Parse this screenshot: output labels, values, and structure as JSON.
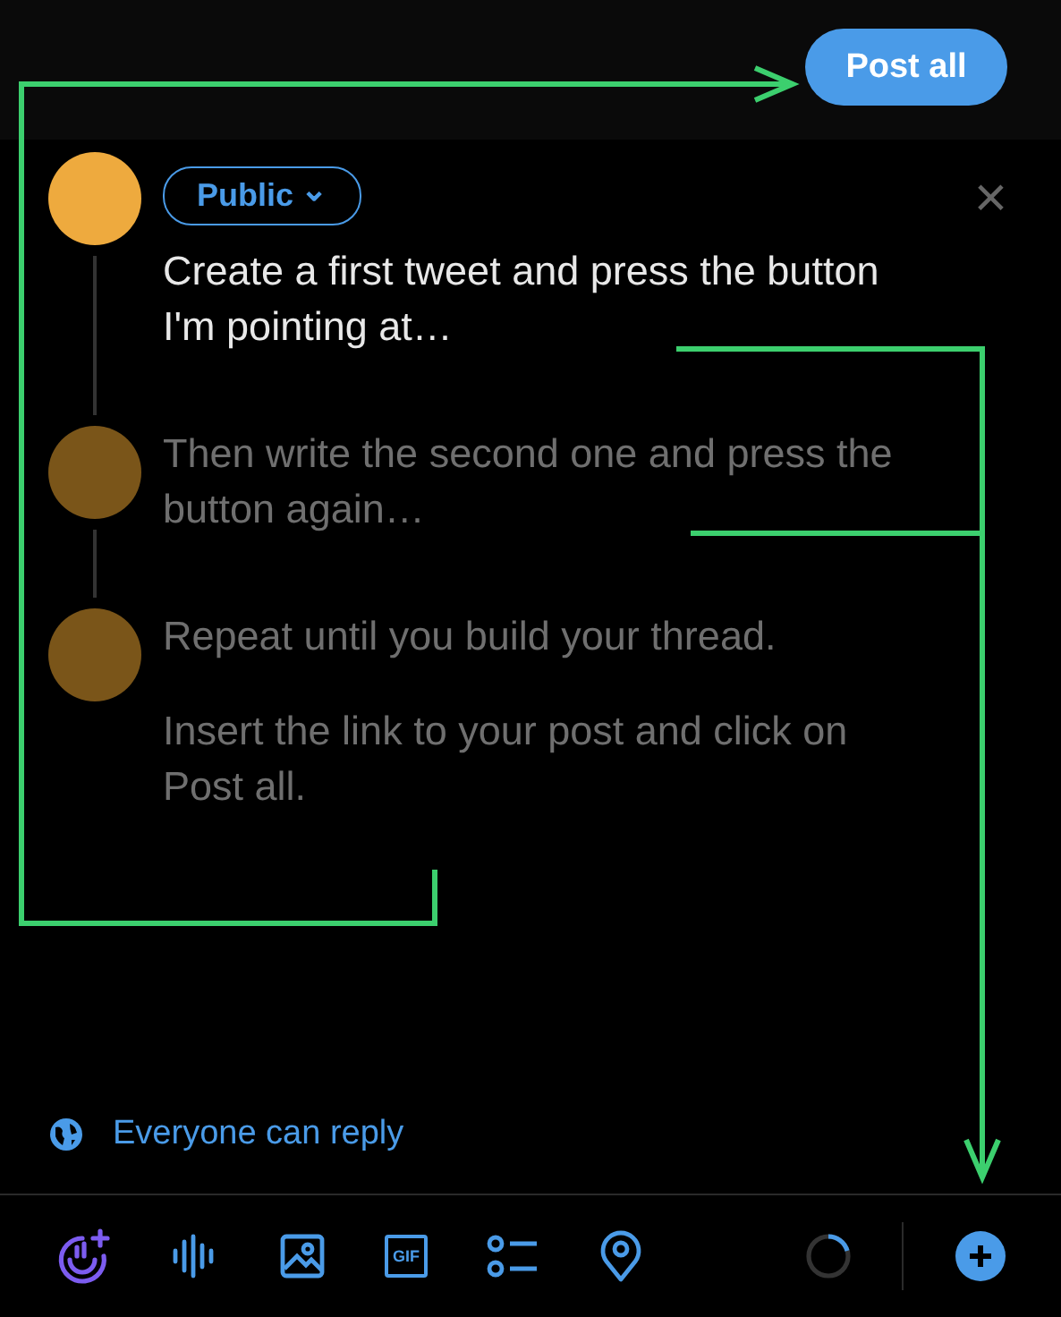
{
  "header": {
    "post_button": "Post all"
  },
  "audience": {
    "label": "Public",
    "caret": "⌄"
  },
  "close": "×",
  "posts": [
    {
      "active": true,
      "paragraphs": [
        "Create a first tweet and press the button I'm pointing at…"
      ]
    },
    {
      "active": false,
      "paragraphs": [
        "Then write the second one and press the button again…"
      ]
    },
    {
      "active": false,
      "paragraphs": [
        "Repeat until you build your thread.",
        "Insert the link to your post and click on Post all."
      ]
    }
  ],
  "reply_setting": "Everyone can reply",
  "toolbar": [
    {
      "kind": "voice"
    },
    {
      "kind": "audio"
    },
    {
      "kind": "image"
    },
    {
      "kind": "gif",
      "label": "GIF"
    },
    {
      "kind": "poll"
    },
    {
      "kind": "location"
    }
  ]
}
